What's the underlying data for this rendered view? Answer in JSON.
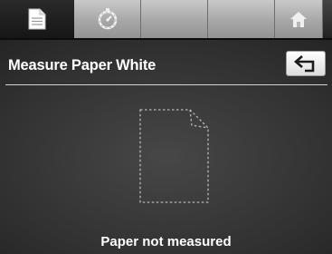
{
  "tabs": [
    {
      "icon": "document-icon",
      "active": true
    },
    {
      "icon": "timer-icon",
      "active": false
    },
    {
      "icon": "",
      "active": false
    },
    {
      "icon": "",
      "active": false
    },
    {
      "icon": "home-icon",
      "active": false
    }
  ],
  "header": {
    "title": "Measure Paper White",
    "back_icon": "back-arrow-icon"
  },
  "main": {
    "placeholder_icon": "paper-outline-icon",
    "status": "Paper not measured"
  },
  "colors": {
    "background_center": "#474747",
    "background_edge": "#111111",
    "text": "#ffffff",
    "tab_inactive": "#a7a7a7",
    "divider": "#d2d2d2"
  }
}
